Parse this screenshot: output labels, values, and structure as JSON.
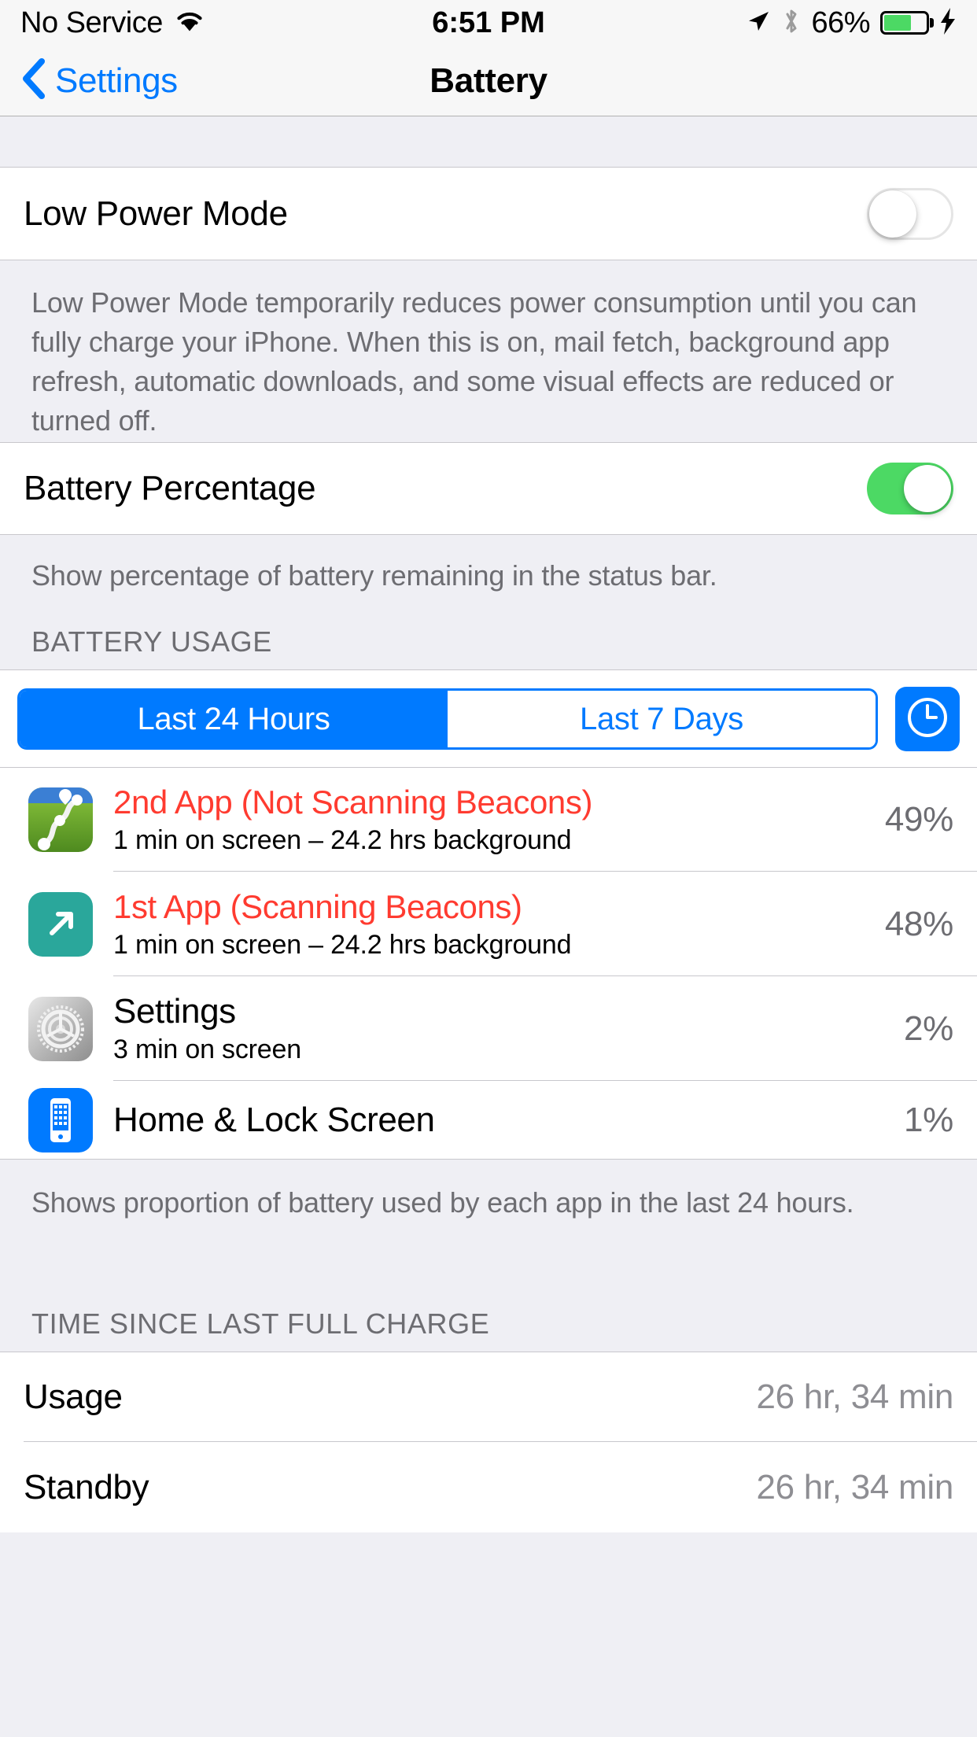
{
  "status_bar": {
    "carrier": "No Service",
    "wifi_icon": "wifi-icon",
    "time": "6:51 PM",
    "location_icon": "location-arrow-icon",
    "bluetooth_icon": "bluetooth-icon",
    "battery_percent": "66%",
    "battery_level": 66,
    "battery_fill_color": "#4CD964",
    "charging_icon": "lightning-bolt-icon"
  },
  "nav": {
    "back_label": "Settings",
    "back_icon": "chevron-left-icon",
    "title": "Battery"
  },
  "low_power": {
    "label": "Low Power Mode",
    "switch_state": "off",
    "footer": "Low Power Mode temporarily reduces power consumption until you can fully charge your iPhone. When this is on, mail fetch, background app refresh, automatic downloads, and some visual effects are reduced or turned off."
  },
  "battery_percentage": {
    "label": "Battery Percentage",
    "switch_state": "on",
    "switch_on_color": "#4CD964",
    "footer": "Show percentage of battery remaining in the status bar."
  },
  "battery_usage": {
    "header": "BATTERY USAGE",
    "segments": [
      {
        "label": "Last 24 Hours",
        "selected": true
      },
      {
        "label": "Last 7 Days",
        "selected": false
      }
    ],
    "accent_color": "#007AFF",
    "clock_button_icon": "clock-icon",
    "apps": [
      {
        "icon": "maps-app-icon",
        "name": "2nd App (Not Scanning Beacons)",
        "name_color": "#FF3B30",
        "detail": "1 min on screen – 24.2 hrs background",
        "percent": "49%"
      },
      {
        "icon": "teal-arrow-app-icon",
        "name": "1st App (Scanning Beacons)",
        "name_color": "#FF3B30",
        "detail": "1 min on screen – 24.2 hrs background",
        "percent": "48%"
      },
      {
        "icon": "settings-gear-icon",
        "name": "Settings",
        "name_color": "#000000",
        "detail": "3 min on screen",
        "percent": "2%"
      },
      {
        "icon": "home-lock-screen-icon",
        "name": "Home & Lock Screen",
        "name_color": "#000000",
        "detail": "",
        "percent": "1%"
      }
    ],
    "footer": "Shows proportion of battery used by each app in the last 24 hours."
  },
  "time_since_charge": {
    "header": "TIME SINCE LAST FULL CHARGE",
    "rows": [
      {
        "label": "Usage",
        "value": "26 hr, 34 min"
      },
      {
        "label": "Standby",
        "value": "26 hr, 34 min"
      }
    ]
  }
}
